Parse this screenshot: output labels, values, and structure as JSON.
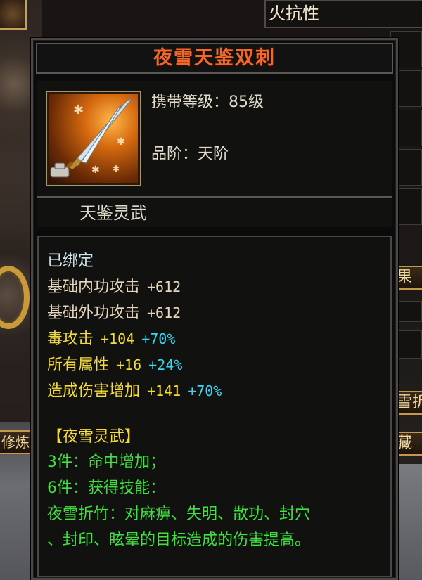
{
  "background": {
    "right_panel_title": "火抗性",
    "left_tab_label": "修炼",
    "right_labels": [
      "果",
      "雪折",
      "藏"
    ]
  },
  "item": {
    "name": "夜雪天鉴双刺",
    "icon": "twin-daggers-icon",
    "level_label": "携带等级：",
    "level_value": "85级",
    "grade_label": "品阶：",
    "grade_value": "天阶",
    "category": "天鉴灵武",
    "bound_status": "已绑定",
    "stats": [
      {
        "name": "基础内功攻击",
        "base": "+612",
        "bonus": "",
        "style": "base"
      },
      {
        "name": "基础外功攻击",
        "base": "+612",
        "bonus": "",
        "style": "base"
      },
      {
        "name": "毒攻击",
        "base": "+104",
        "bonus": "+70%",
        "style": "yellow"
      },
      {
        "name": "所有属性",
        "base": "+16",
        "bonus": "+24%",
        "style": "yellow"
      },
      {
        "name": "造成伤害增加",
        "base": "+141",
        "bonus": "+70%",
        "style": "yellow"
      }
    ],
    "set": {
      "name": "【夜雪灵武】",
      "lines": [
        "3件：命中增加；",
        "6件：获得技能：",
        "夜雪折竹：对麻痹、失明、散功、封穴",
        "、封印、眩晕的目标造成的伤害提高。"
      ]
    }
  },
  "colors": {
    "title": "#f0682a",
    "bound": "#cfe7ee",
    "base_stat": "#e5d6bd",
    "yellow_stat": "#f5dc3c",
    "cyan_bonus": "#39d8f0",
    "set_green": "#40e040"
  }
}
